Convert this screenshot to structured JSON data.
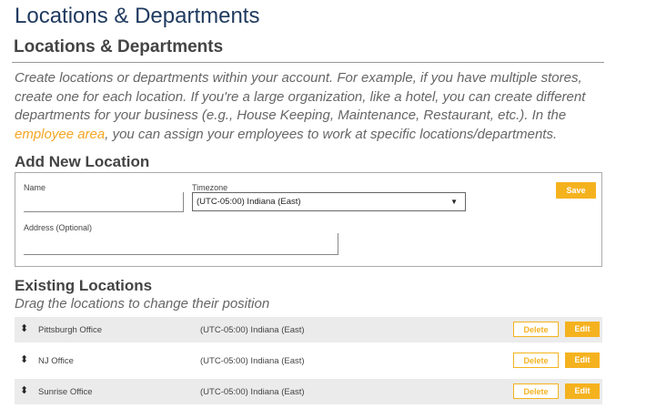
{
  "page": {
    "title": "Locations & Departments",
    "section_title": "Locations & Departments"
  },
  "intro": {
    "text_before_link": "Create locations or departments within your account. For example, if you have multiple stores, create one for each location. If you're a large organization, like a hotel, you can create different departments for your business (e.g., House Keeping, Maintenance, Restaurant, etc.). In the ",
    "link_text": "employee area",
    "text_after_link": ", you can assign your employees to work at specific locations/departments."
  },
  "add_location": {
    "title": "Add New Location",
    "name_label": "Name",
    "name_value": "",
    "timezone_label": "Timezone",
    "timezone_value": "(UTC-05:00) Indiana (East)",
    "address_label": "Address (Optional)",
    "address_value": "",
    "save_label": "Save"
  },
  "existing": {
    "title": "Existing Locations",
    "subtitle": "Drag the locations to change their position",
    "delete_label": "Delete",
    "edit_label": "Edit",
    "drag_icon": "⬍",
    "locations": [
      {
        "name": "Pittsburgh Office",
        "timezone": "(UTC-05:00) Indiana (East)"
      },
      {
        "name": "NJ Office",
        "timezone": "(UTC-05:00) Indiana (East)"
      },
      {
        "name": "Sunrise Office",
        "timezone": "(UTC-05:00) Indiana (East)"
      }
    ]
  },
  "colors": {
    "accent": "#f5b21f",
    "title": "#1f3a5f",
    "row_shade": "#ebebeb"
  }
}
